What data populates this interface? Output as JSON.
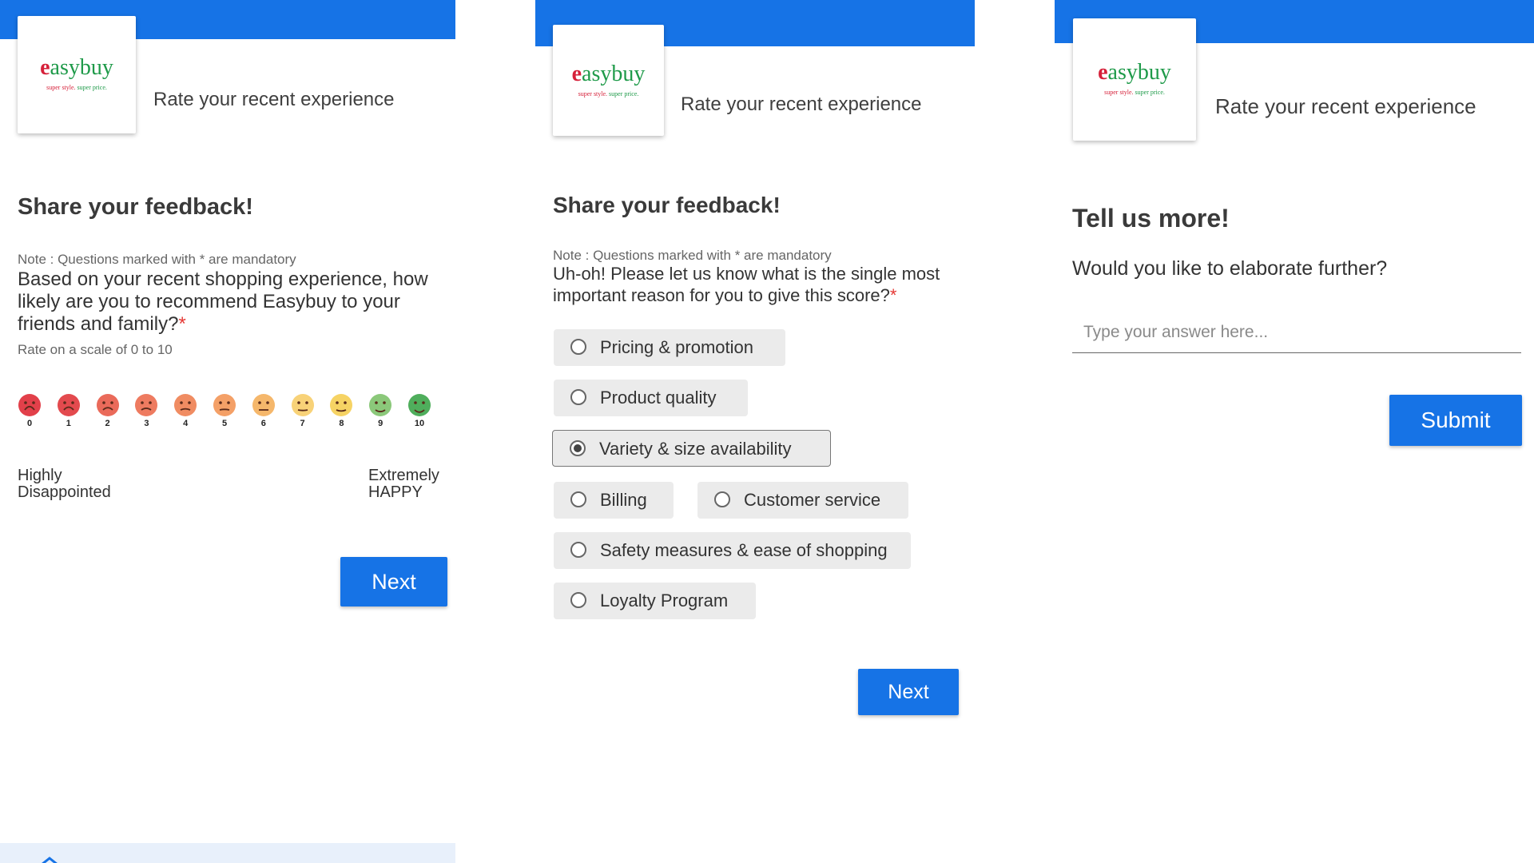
{
  "brand": {
    "logo_initial": "e",
    "logo_rest": "asybuy",
    "tagline_part1": "super style.",
    "tagline_part2": "super price.",
    "accent_color": "#1673e6",
    "logo_red": "#d6213a",
    "logo_green": "#1e9a49"
  },
  "panel1": {
    "header_title": "Rate your recent experience",
    "heading": "Share your feedback!",
    "note": "Note : Questions marked with * are mandatory",
    "question": "Based on your recent shopping experience, how likely are you to recommend Easybuy to your friends and family?",
    "required_mark": "*",
    "scale_hint": "Rate on a scale of 0 to 10",
    "scale": [
      {
        "value": "0",
        "color": "#e2404a",
        "icon": "face-dizzy-icon"
      },
      {
        "value": "1",
        "color": "#e34a4e",
        "icon": "face-squint-angry-icon"
      },
      {
        "value": "2",
        "color": "#ea6a5a",
        "icon": "face-disappointed-icon"
      },
      {
        "value": "3",
        "color": "#ee7b60",
        "icon": "face-frown-icon"
      },
      {
        "value": "4",
        "color": "#f08c62",
        "icon": "face-slight-frown-icon"
      },
      {
        "value": "5",
        "color": "#f4a067",
        "icon": "face-slight-smile-icon"
      },
      {
        "value": "6",
        "color": "#f5b76b",
        "icon": "face-expressionless-icon"
      },
      {
        "value": "7",
        "color": "#f8d278",
        "icon": "face-neutral-icon"
      },
      {
        "value": "8",
        "color": "#f6d364",
        "icon": "face-grin-icon"
      },
      {
        "value": "9",
        "color": "#8bc87a",
        "icon": "face-big-grin-icon"
      },
      {
        "value": "10",
        "color": "#4fae5c",
        "icon": "face-heart-eyes-icon"
      }
    ],
    "low_label_line1": "Highly",
    "low_label_line2": "Disappointed",
    "high_label_line1": "Extremely",
    "high_label_line2": "HAPPY",
    "next_label": "Next"
  },
  "panel2": {
    "header_title": "Rate your recent experience",
    "heading": "Share your feedback!",
    "note": "Note : Questions marked with * are mandatory",
    "question": "Uh-oh! Please let us know what is the single most important reason for you to give this score?",
    "required_mark": "*",
    "options": [
      {
        "label": "Pricing & promotion",
        "selected": false
      },
      {
        "label": "Product quality",
        "selected": false
      },
      {
        "label": "Variety & size availability",
        "selected": true
      },
      {
        "label": "Billing",
        "selected": false
      },
      {
        "label": "Customer service",
        "selected": false
      },
      {
        "label": "Safety measures & ease of shopping",
        "selected": false
      },
      {
        "label": "Loyalty Program",
        "selected": false
      }
    ],
    "next_label": "Next"
  },
  "panel3": {
    "header_title": "Rate your recent experience",
    "heading": "Tell us more!",
    "question": "Would you like to elaborate further?",
    "answer_value": "",
    "answer_placeholder": "Type your answer here...",
    "submit_label": "Submit"
  }
}
